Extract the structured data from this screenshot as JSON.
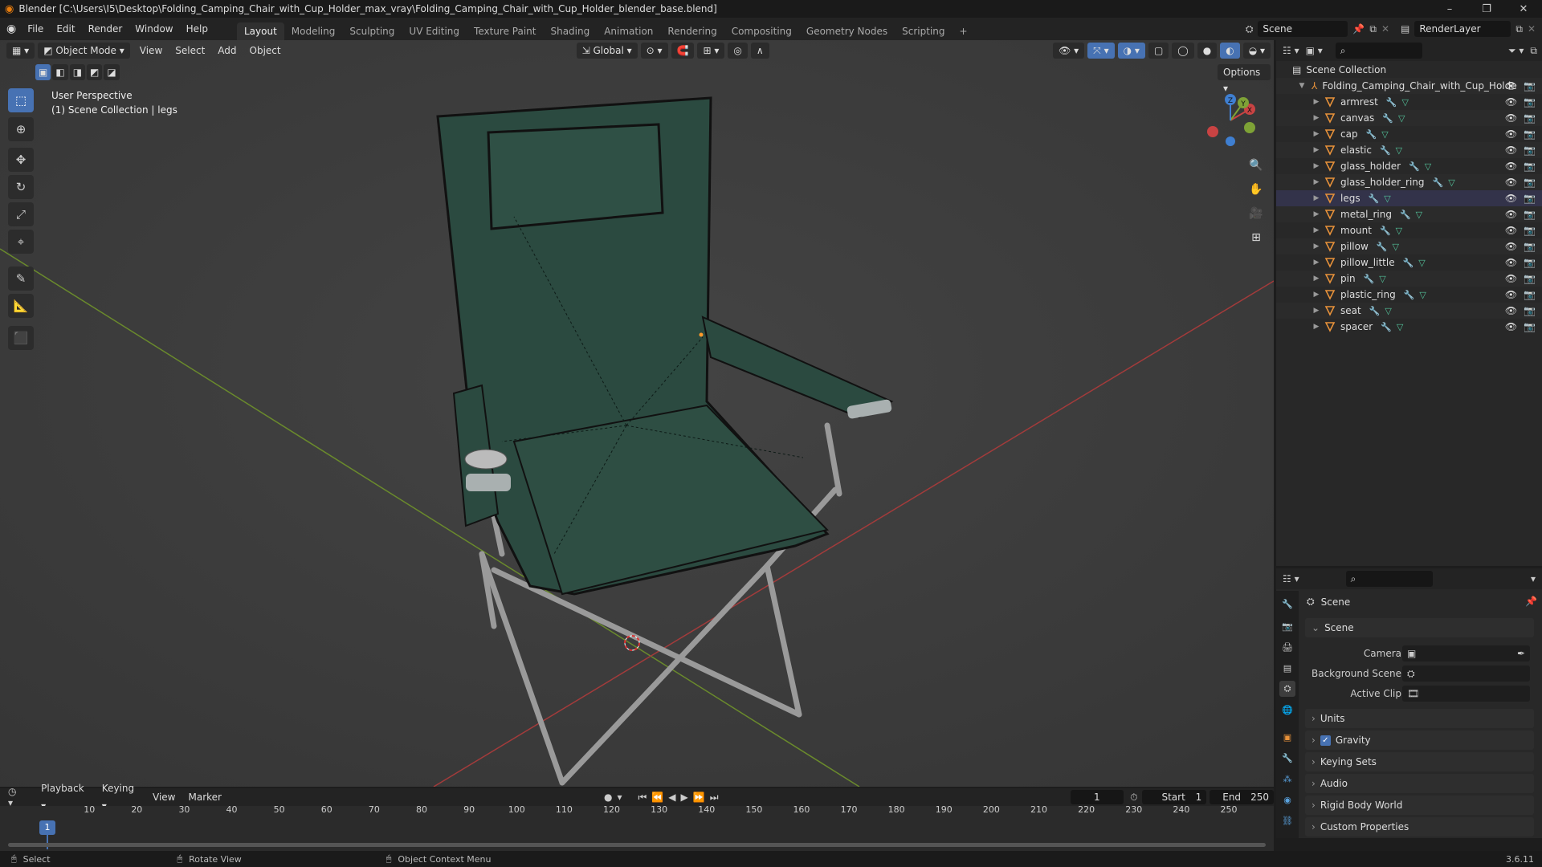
{
  "window": {
    "title": "Blender [C:\\Users\\I5\\Desktop\\Folding_Camping_Chair_with_Cup_Holder_max_vray\\Folding_Camping_Chair_with_Cup_Holder_blender_base.blend]"
  },
  "menu": [
    "File",
    "Edit",
    "Render",
    "Window",
    "Help"
  ],
  "workspaces": [
    "Layout",
    "Modeling",
    "Sculpting",
    "UV Editing",
    "Texture Paint",
    "Shading",
    "Animation",
    "Rendering",
    "Compositing",
    "Geometry Nodes",
    "Scripting"
  ],
  "header_right": {
    "scene": "Scene",
    "view_layer": "RenderLayer"
  },
  "viewport": {
    "mode": "Object Mode",
    "menus": [
      "View",
      "Select",
      "Add",
      "Object"
    ],
    "orientation": "Global",
    "options_label": "Options",
    "perspective": "User Perspective",
    "collection_info": "(1) Scene Collection | legs",
    "gizmo": {
      "x": "X",
      "y": "Y",
      "z": "Z"
    }
  },
  "outliner": {
    "root": "Scene Collection",
    "collection": "Folding_Camping_Chair_with_Cup_Holde",
    "objects": [
      "armrest",
      "canvas",
      "cap",
      "elastic",
      "glass_holder",
      "glass_holder_ring",
      "legs",
      "metal_ring",
      "mount",
      "pillow",
      "pillow_little",
      "pin",
      "plastic_ring",
      "seat",
      "spacer"
    ]
  },
  "properties": {
    "context": "Scene",
    "panel_scene": "Scene",
    "camera_label": "Camera",
    "background_scene_label": "Background Scene",
    "active_clip_label": "Active Clip",
    "panels": [
      "Units",
      "Gravity",
      "Keying Sets",
      "Audio",
      "Rigid Body World",
      "Custom Properties"
    ],
    "gravity_checked": true
  },
  "timeline": {
    "menus": [
      "Playback",
      "Keying",
      "View",
      "Marker"
    ],
    "current_frame": "1",
    "start_label": "Start",
    "start": "1",
    "end_label": "End",
    "end": "250",
    "ticks": [
      "1",
      "10",
      "20",
      "30",
      "40",
      "50",
      "60",
      "70",
      "80",
      "90",
      "100",
      "110",
      "120",
      "130",
      "140",
      "150",
      "160",
      "170",
      "180",
      "190",
      "200",
      "210",
      "220",
      "230",
      "240",
      "250"
    ]
  },
  "statusbar": {
    "select": "Select",
    "rotate": "Rotate View",
    "context_menu": "Object Context Menu",
    "version": "3.6.11"
  },
  "colors": {
    "accent": "#4772b3",
    "object_icon": "#e8923a",
    "x_axis": "#c94343",
    "y_axis": "#7ea236",
    "z_axis": "#3f7fd1",
    "canvas": "#2b4a40"
  }
}
